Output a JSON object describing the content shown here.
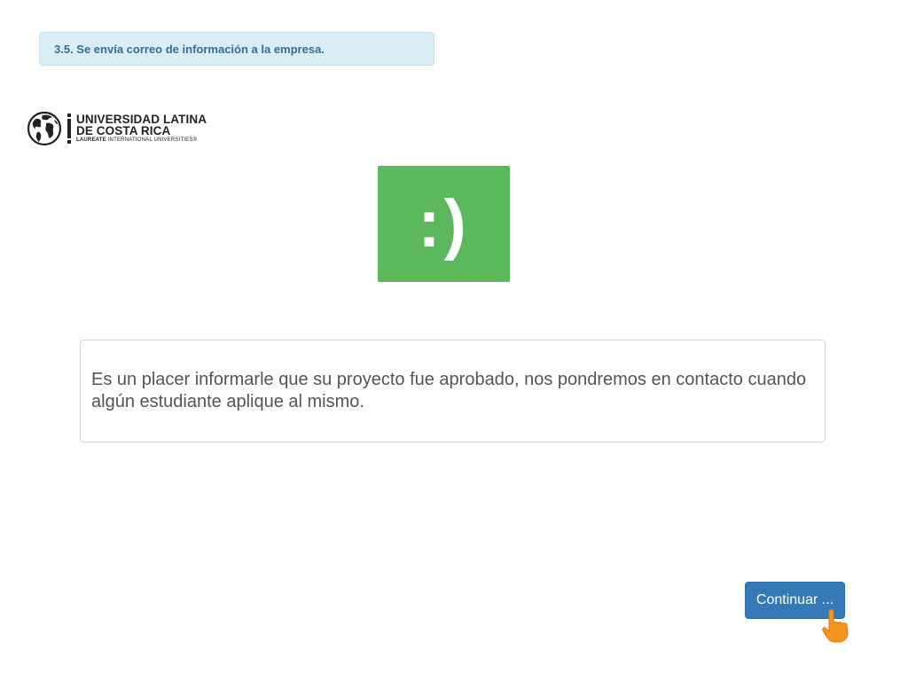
{
  "step_banner": {
    "text": "3.5. Se envía correo de información a la empresa."
  },
  "logo": {
    "line1": "UNIVERSIDAD LATINA",
    "line2": "DE COSTA RICA",
    "line3_bold": "LAUREATE",
    "line3_rest": " INTERNATIONAL UNIVERSITIES®"
  },
  "smiley": {
    "text": ":)",
    "color": "#5cb85c"
  },
  "message": {
    "text": "Es un placer informarle que su proyecto fue aprobado, nos pondremos en contacto cuando algún estudiante aplique al mismo."
  },
  "continue_button": {
    "label": "Continuar ...",
    "color": "#337ab7"
  },
  "cursor": {
    "icon": "pointing-hand-icon",
    "color": "#f7941d"
  }
}
